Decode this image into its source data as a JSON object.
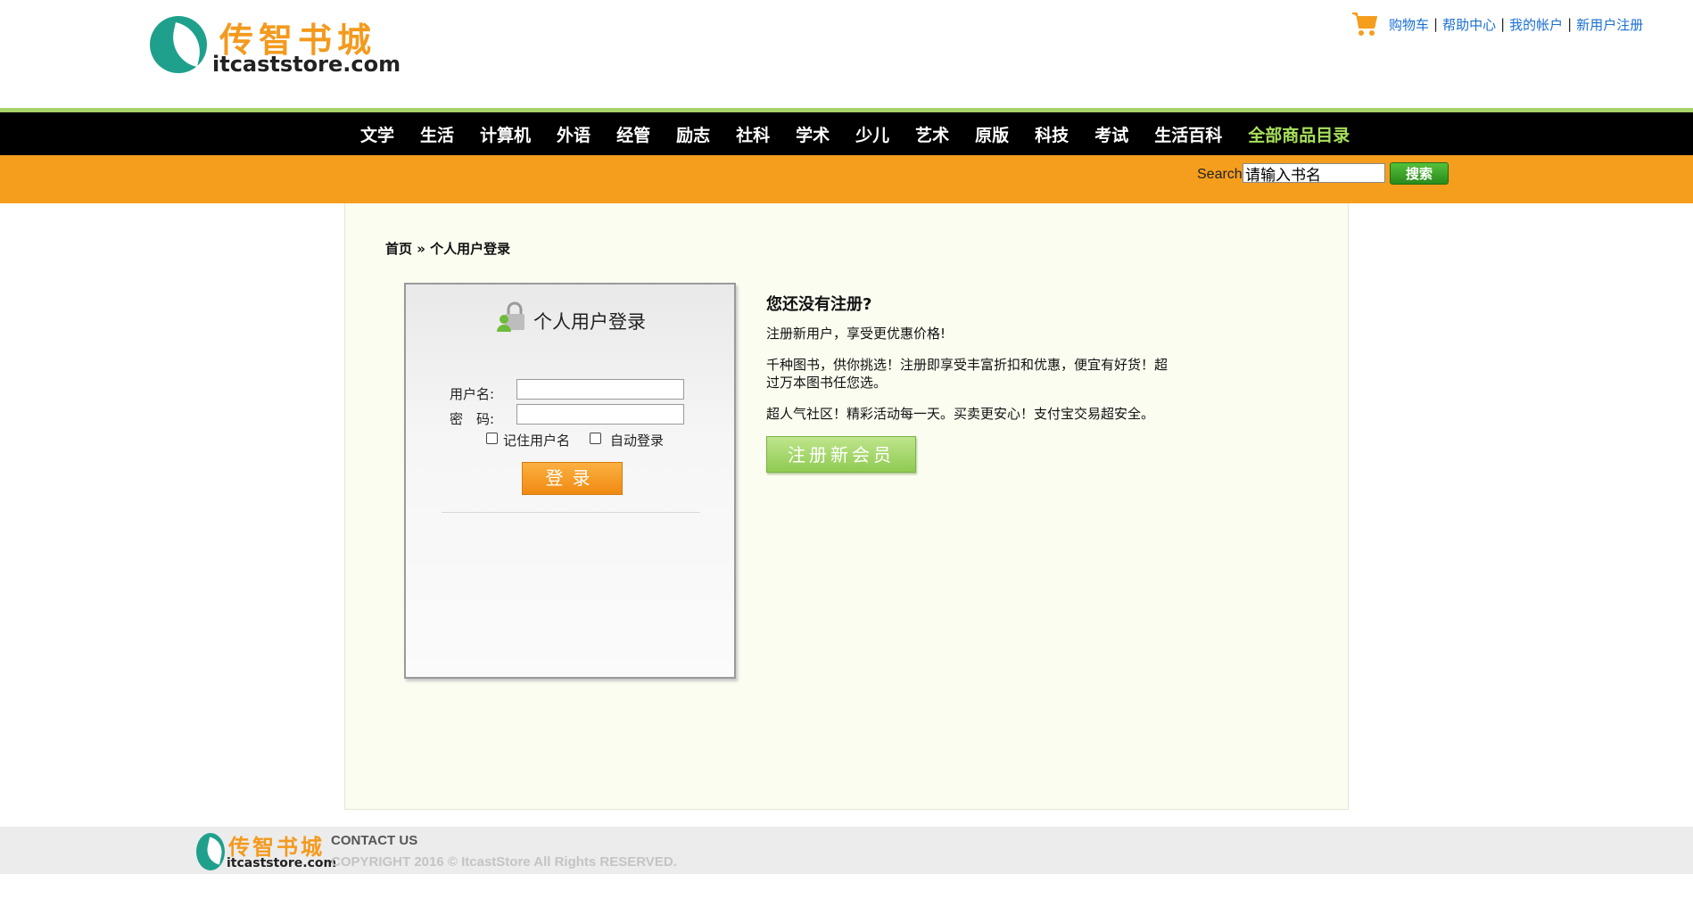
{
  "brand": {
    "name_cn": "传智书城",
    "name_en": "itcaststore.com",
    "accent_color": "#f39a1e",
    "logo_color": "#1fa08c"
  },
  "toplinks": {
    "cart_icon": "shopping-cart-icon",
    "items": [
      "购物车",
      "帮助中心",
      "我的帐户",
      "新用户注册"
    ],
    "separator": "|"
  },
  "nav": {
    "items": [
      "文学",
      "生活",
      "计算机",
      "外语",
      "经管",
      "励志",
      "社科",
      "学术",
      "少儿",
      "艺术",
      "原版",
      "科技",
      "考试",
      "生活百科"
    ],
    "all_label": "全部商品目录",
    "background": "#000000",
    "highlight_color": "#a8e05a"
  },
  "search": {
    "label": "Search",
    "value": "请输入书名",
    "button_label": "搜索",
    "bar_color": "#f59e1e"
  },
  "breadcrumb": {
    "text": "首页 » 个人用户登录"
  },
  "login": {
    "title": "个人用户登录",
    "icon": "user-lock-icon",
    "username_label": "用户名:",
    "password_label": "密　码:",
    "remember_label": "记住用户名",
    "auto_label": "自动登录",
    "button_label": "登录"
  },
  "register": {
    "heading": "您还没有注册?",
    "p1": "注册新用户，享受更优惠价格!",
    "p2": "千种图书，供你挑选！注册即享受丰富折扣和优惠，便宜有好货！超过万本图书任您选。",
    "p3": "超人气社区！精彩活动每一天。买卖更安心！支付宝交易超安全。",
    "button_label": "注册新会员",
    "button_color": "#8fcb52"
  },
  "footer": {
    "contact": "CONTACT US",
    "copyright": "COPYRIGHT 2016 © ItcastStore All Rights RESERVED."
  }
}
